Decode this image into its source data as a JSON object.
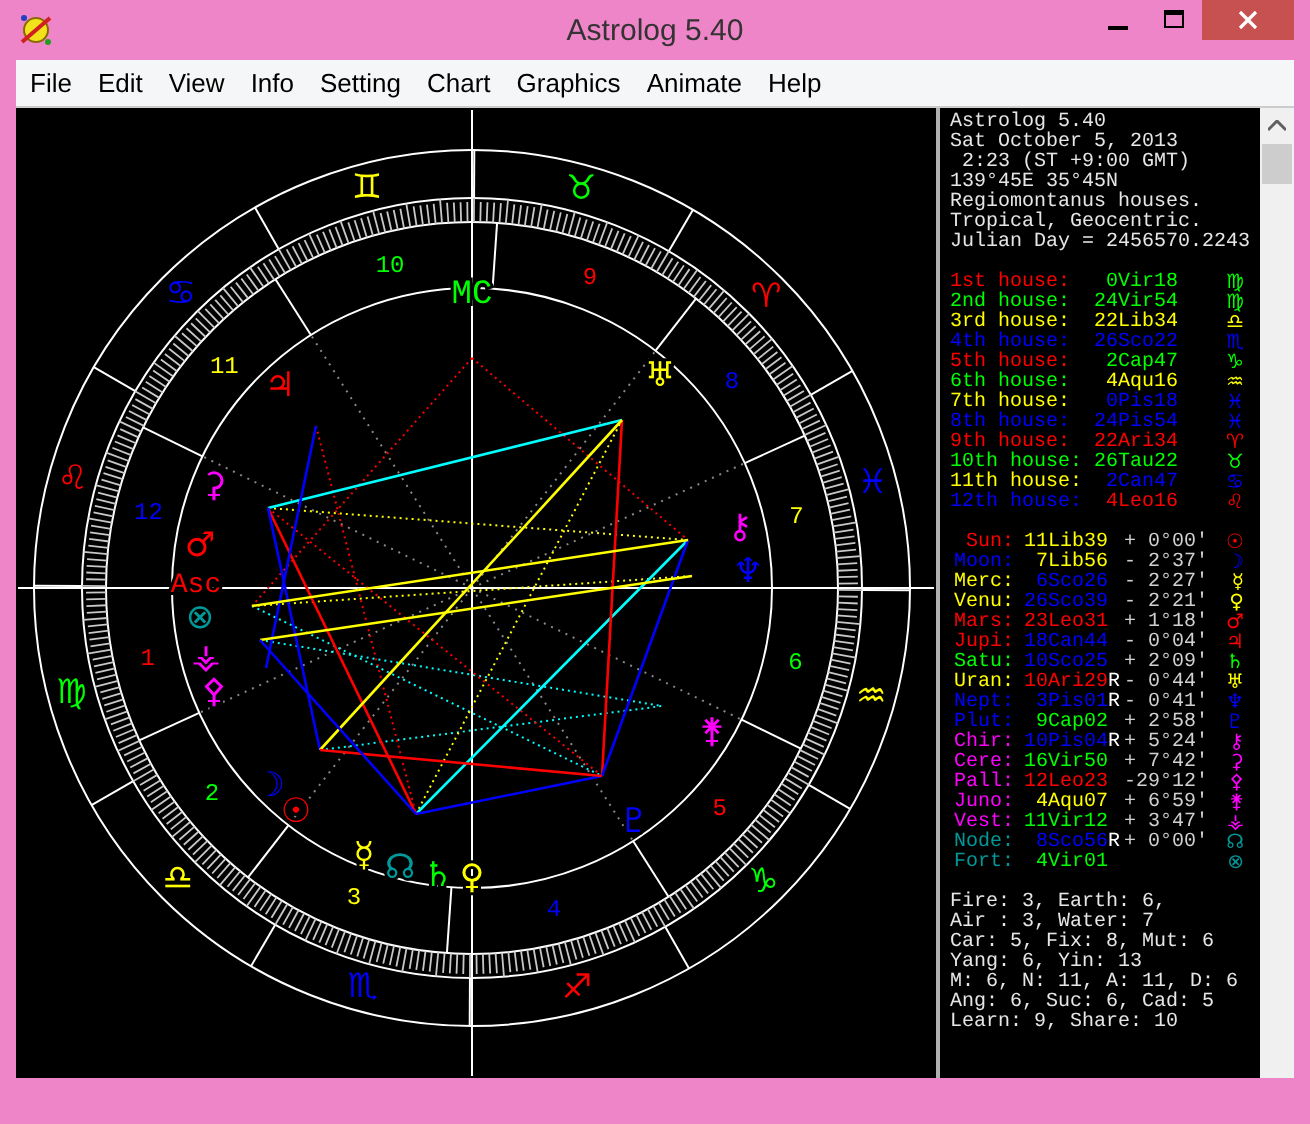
{
  "window": {
    "title": "Astrolog 5.40"
  },
  "menu": [
    "File",
    "Edit",
    "View",
    "Info",
    "Setting",
    "Chart",
    "Graphics",
    "Animate",
    "Help"
  ],
  "chart": {
    "mc_label": "MC",
    "asc_label": "Asc",
    "signs": [
      {
        "glyph": "♈",
        "color": "#ff0000"
      },
      {
        "glyph": "♉",
        "color": "#00ff00"
      },
      {
        "glyph": "♊",
        "color": "#ffff00"
      },
      {
        "glyph": "♋",
        "color": "#0000ff"
      },
      {
        "glyph": "♌",
        "color": "#ff0000"
      },
      {
        "glyph": "♍",
        "color": "#00ff00"
      },
      {
        "glyph": "♎",
        "color": "#ffff00"
      },
      {
        "glyph": "♏",
        "color": "#0000ff"
      },
      {
        "glyph": "♐",
        "color": "#ff0000"
      },
      {
        "glyph": "♑",
        "color": "#00ff00"
      },
      {
        "glyph": "♒",
        "color": "#ffff00"
      },
      {
        "glyph": "♓",
        "color": "#0000ff"
      }
    ],
    "houses": [
      {
        "number": "1",
        "color": "#ff0000"
      },
      {
        "number": "2",
        "color": "#00ff00"
      },
      {
        "number": "3",
        "color": "#ffff00"
      },
      {
        "number": "4",
        "color": "#0000ff"
      },
      {
        "number": "5",
        "color": "#ff0000"
      },
      {
        "number": "6",
        "color": "#00ff00"
      },
      {
        "number": "7",
        "color": "#ffff00"
      },
      {
        "number": "8",
        "color": "#0000ff"
      },
      {
        "number": "9",
        "color": "#ff0000"
      },
      {
        "number": "10",
        "color": "#00ff00"
      },
      {
        "number": "11",
        "color": "#ffff00"
      },
      {
        "number": "12",
        "color": "#0000ff"
      }
    ],
    "planets": [
      {
        "glyph": "☉",
        "color": "#ff0000"
      },
      {
        "glyph": "☽",
        "color": "#0000ff"
      },
      {
        "glyph": "☿",
        "color": "#ffff00"
      },
      {
        "glyph": "♀",
        "color": "#ffff00"
      },
      {
        "glyph": "♂",
        "color": "#ff0000"
      },
      {
        "glyph": "♃",
        "color": "#ff0000"
      },
      {
        "glyph": "♄",
        "color": "#00ff00"
      },
      {
        "glyph": "♅",
        "color": "#ffff00"
      },
      {
        "glyph": "♆",
        "color": "#0000ff"
      },
      {
        "glyph": "♇",
        "color": "#0000ff"
      },
      {
        "glyph": "⚷",
        "color": "#ff00ff"
      },
      {
        "glyph": "⚳",
        "color": "#ff00ff"
      },
      {
        "glyph": "⚴",
        "color": "#ff00ff"
      },
      {
        "glyph": "⚵",
        "color": "#ff00ff"
      },
      {
        "glyph": "⚶",
        "color": "#ff00ff"
      },
      {
        "glyph": "☊",
        "color": "#009999"
      },
      {
        "glyph": "⊗",
        "color": "#009999"
      }
    ]
  },
  "info": [
    "Astrolog 5.40",
    "Sat October 5, 2013",
    " 2:23 (ST +9:00 GMT)",
    "139°45E 35°45N",
    "Regiomontanus houses.",
    "Tropical, Geocentric.",
    "Julian Day = 2456570.2243"
  ],
  "house_cusps": [
    {
      "label": "1st house:",
      "color": "#ff0000",
      "position": {
        "text": "0Vir18",
        "color": "#00ff00"
      },
      "glyph": "♍"
    },
    {
      "label": "2nd house:",
      "color": "#00ff00",
      "position": {
        "text": "24Vir54",
        "color": "#00ff00"
      },
      "glyph": "♍"
    },
    {
      "label": "3rd house:",
      "color": "#ffff00",
      "position": {
        "text": "22Lib34",
        "color": "#ffff00"
      },
      "glyph": "♎"
    },
    {
      "label": "4th house:",
      "color": "#0000ff",
      "position": {
        "text": "26Sco22",
        "color": "#0000ff"
      },
      "glyph": "♏"
    },
    {
      "label": "5th house:",
      "color": "#ff0000",
      "position": {
        "text": "2Cap47",
        "color": "#00ff00"
      },
      "glyph": "♑"
    },
    {
      "label": "6th house:",
      "color": "#00ff00",
      "position": {
        "text": "4Aqu16",
        "color": "#ffff00"
      },
      "glyph": "♒"
    },
    {
      "label": "7th house:",
      "color": "#ffff00",
      "position": {
        "text": "0Pis18",
        "color": "#0000ff"
      },
      "glyph": "♓"
    },
    {
      "label": "8th house:",
      "color": "#0000ff",
      "position": {
        "text": "24Pis54",
        "color": "#0000ff"
      },
      "glyph": "♓"
    },
    {
      "label": "9th house:",
      "color": "#ff0000",
      "position": {
        "text": "22Ari34",
        "color": "#ff0000"
      },
      "glyph": "♈"
    },
    {
      "label": "10th house:",
      "color": "#00ff00",
      "position": {
        "text": "26Tau22",
        "color": "#00ff00"
      },
      "glyph": "♉"
    },
    {
      "label": "11th house:",
      "color": "#ffff00",
      "position": {
        "text": "2Can47",
        "color": "#0000ff"
      },
      "glyph": "♋"
    },
    {
      "label": "12th house:",
      "color": "#0000ff",
      "position": {
        "text": "4Leo16",
        "color": "#ff0000"
      },
      "glyph": "♌"
    }
  ],
  "planets": [
    {
      "name": "Sun:",
      "color": "#ff0000",
      "position": {
        "text": "11Lib39",
        "color": "#ffff00"
      },
      "latitude": "+ 0°00′",
      "glyph": "☉"
    },
    {
      "name": "Moon:",
      "color": "#0000ff",
      "position": {
        "text": "7Lib56",
        "color": "#ffff00"
      },
      "latitude": "- 2°37′",
      "glyph": "☽"
    },
    {
      "name": "Merc:",
      "color": "#ffff00",
      "position": {
        "text": "6Sco26",
        "color": "#0000ff"
      },
      "latitude": "- 2°27′",
      "glyph": "☿"
    },
    {
      "name": "Venu:",
      "color": "#ffff00",
      "position": {
        "text": "26Sco39",
        "color": "#0000ff"
      },
      "latitude": "- 2°21′",
      "glyph": "♀"
    },
    {
      "name": "Mars:",
      "color": "#ff0000",
      "position": {
        "text": "23Leo31",
        "color": "#ff0000"
      },
      "latitude": "+ 1°18′",
      "glyph": "♂"
    },
    {
      "name": "Jupi:",
      "color": "#ff0000",
      "position": {
        "text": "18Can44",
        "color": "#0000ff"
      },
      "latitude": "- 0°04′",
      "glyph": "♃"
    },
    {
      "name": "Satu:",
      "color": "#00ff00",
      "position": {
        "text": "10Sco25",
        "color": "#0000ff"
      },
      "latitude": "+ 2°09′",
      "glyph": "♄"
    },
    {
      "name": "Uran:",
      "color": "#ffff00",
      "position": {
        "text": "10Ari29",
        "color": "#ff0000"
      },
      "motion": "R",
      "latitude": "- 0°44′",
      "glyph": "♅"
    },
    {
      "name": "Nept:",
      "color": "#0000ff",
      "position": {
        "text": "3Pis01",
        "color": "#0000ff"
      },
      "motion": "R",
      "latitude": "- 0°41′",
      "glyph": "♆"
    },
    {
      "name": "Plut:",
      "color": "#0000ff",
      "position": {
        "text": "9Cap02",
        "color": "#00ff00"
      },
      "latitude": "+ 2°58′",
      "glyph": "♇"
    },
    {
      "name": "Chir:",
      "color": "#ff00ff",
      "position": {
        "text": "10Pis04",
        "color": "#0000ff"
      },
      "motion": "R",
      "latitude": "+ 5°24′",
      "glyph": "⚷"
    },
    {
      "name": "Cere:",
      "color": "#ff00ff",
      "position": {
        "text": "16Vir50",
        "color": "#00ff00"
      },
      "latitude": "+ 7°42′",
      "glyph": "⚳"
    },
    {
      "name": "Pall:",
      "color": "#ff00ff",
      "position": {
        "text": "12Leo23",
        "color": "#ff0000"
      },
      "latitude": "-29°12′",
      "glyph": "⚴"
    },
    {
      "name": "Juno:",
      "color": "#ff00ff",
      "position": {
        "text": "4Aqu07",
        "color": "#ffff00"
      },
      "latitude": "+ 6°59′",
      "glyph": "⚵"
    },
    {
      "name": "Vest:",
      "color": "#ff00ff",
      "position": {
        "text": "11Vir12",
        "color": "#00ff00"
      },
      "latitude": "+ 3°47′",
      "glyph": "⚶"
    },
    {
      "name": "Node:",
      "color": "#009999",
      "position": {
        "text": "8Sco56",
        "color": "#0000ff"
      },
      "motion": "R",
      "latitude": "+ 0°00′",
      "glyph": "☊"
    },
    {
      "name": "Fort:",
      "color": "#009999",
      "position": {
        "text": "4Vir01",
        "color": "#00ff00"
      },
      "glyph": "⊗"
    }
  ],
  "stats": [
    "Fire: 3, Earth: 6,",
    "Air : 3, Water: 7",
    "Car: 5, Fix: 8, Mut: 6",
    "Yang: 6, Yin: 13",
    "M: 6, N: 11, A: 11, D: 6",
    "Ang: 6, Suc: 6, Cad: 5",
    "Learn: 9, Share: 10"
  ]
}
